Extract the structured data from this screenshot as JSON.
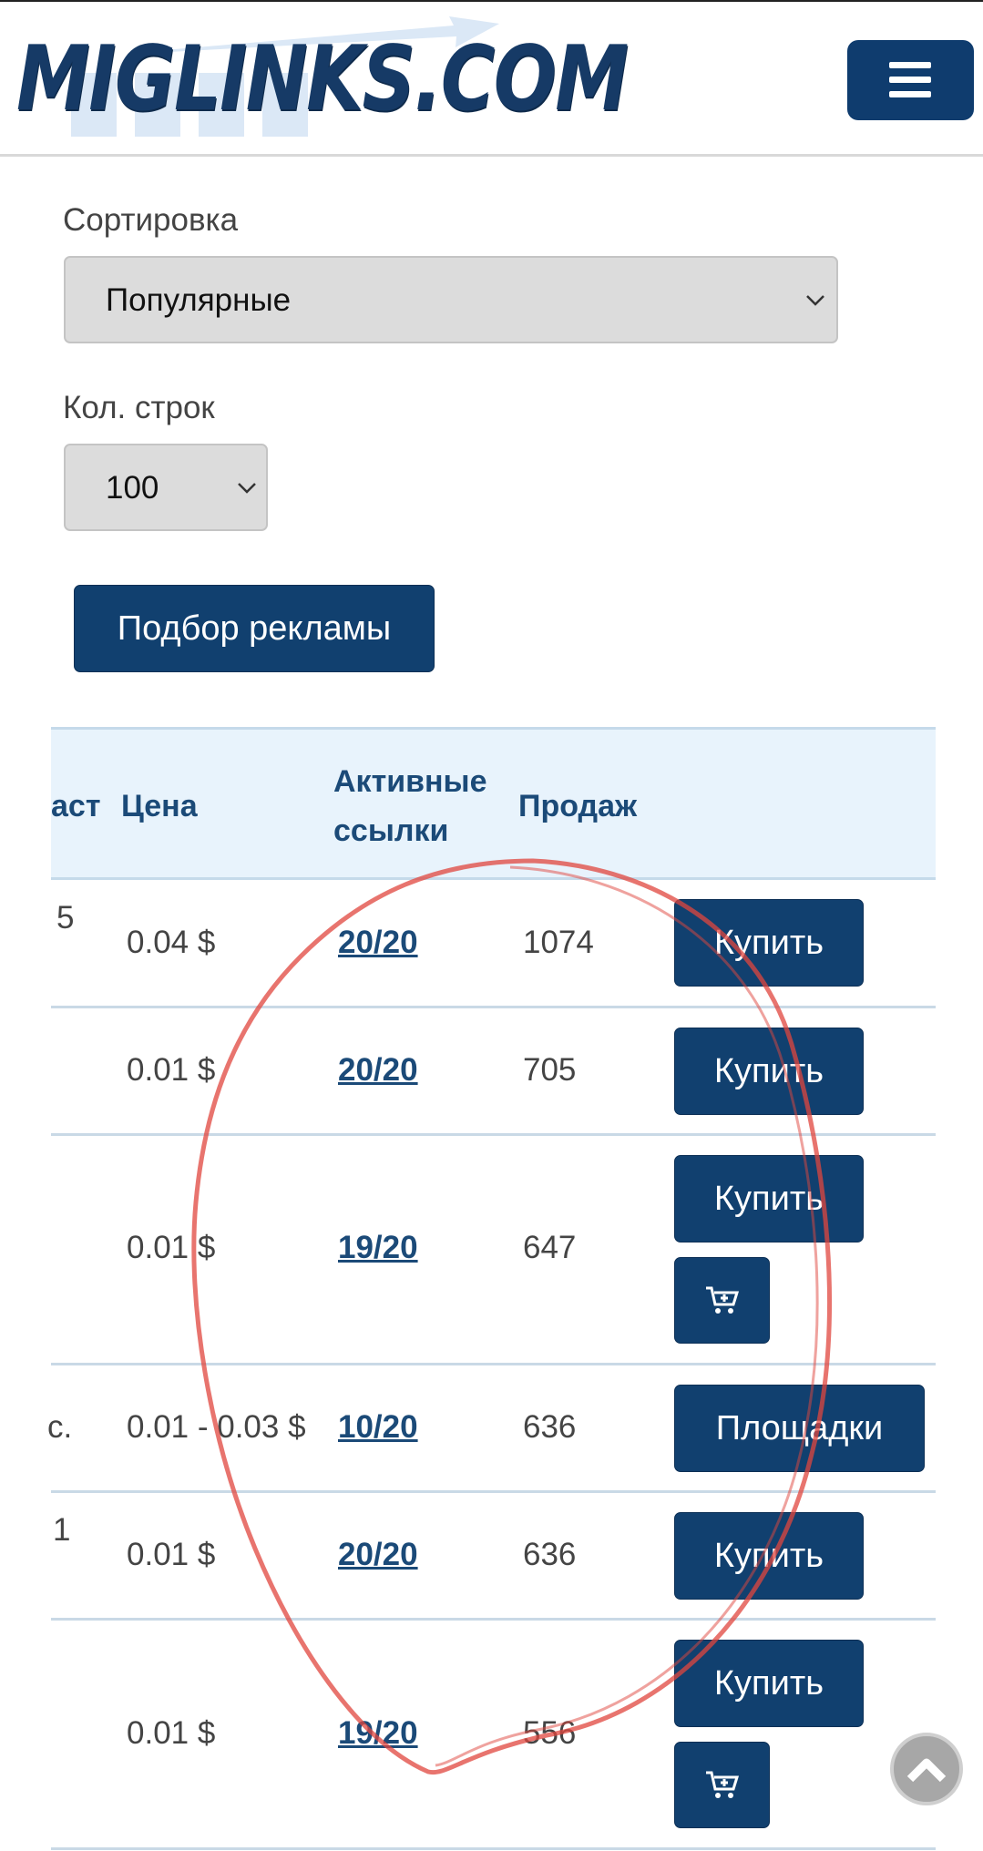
{
  "header": {
    "logo_text": "MIGLINKS.COM",
    "menu_icon": "hamburger-icon"
  },
  "filters": {
    "sort_label": "Сортировка",
    "sort_value": "Популярные",
    "rows_label": "Кол. строк",
    "rows_value": "100",
    "submit_label": "Подбор рекламы"
  },
  "table": {
    "headers": {
      "partial": "аст",
      "price": "Цена",
      "active_line1": "Активные",
      "active_line2": "ссылки",
      "sales": "Продаж"
    },
    "rows": [
      {
        "partial": "5",
        "price": "0.04 $",
        "active": "20/20",
        "sales": "1074",
        "action": "Купить",
        "cart": false
      },
      {
        "partial": "",
        "price": "0.01 $",
        "active": "20/20",
        "sales": "705",
        "action": "Купить",
        "cart": false
      },
      {
        "partial": "",
        "price": "0.01 $",
        "active": "19/20",
        "sales": "647",
        "action": "Купить",
        "cart": true
      },
      {
        "partial": "с.",
        "price": "0.01 - 0.03 $",
        "active": "10/20",
        "sales": "636",
        "action": "Площадки",
        "cart": false
      },
      {
        "partial": "1",
        "price": "0.01 $",
        "active": "20/20",
        "sales": "636",
        "action": "Купить",
        "cart": false
      },
      {
        "partial": "",
        "price": "0.01 $",
        "active": "19/20",
        "sales": "556",
        "action": "Купить",
        "cart": true
      }
    ]
  },
  "colors": {
    "primary": "#11406f",
    "header_bg": "#e8f3fc",
    "annotation": "#e0453d"
  },
  "icons": {
    "cart": "cart-plus-icon",
    "scroll_top": "chevron-up-icon",
    "select": "chevron-down-icon"
  }
}
